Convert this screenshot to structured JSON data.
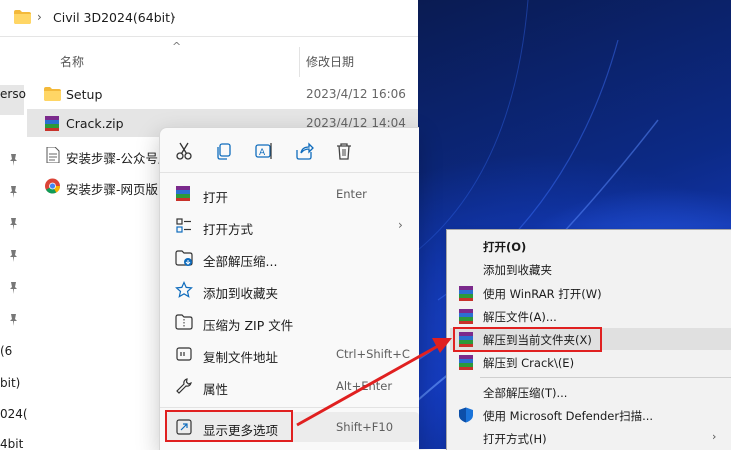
{
  "breadcrumb": {
    "path": "Civil 3D2024(64bit)"
  },
  "columns": {
    "name": "名称",
    "date": "修改日期"
  },
  "files": [
    {
      "name": "Setup",
      "date": "2023/4/12 16:06",
      "icon": "folder-icon"
    },
    {
      "name": "Crack.zip",
      "date": "2023/4/12 14:04",
      "icon": "winrar-archive-icon"
    },
    {
      "name": "安装步骤-公众号版",
      "date": "",
      "icon": "text-document-icon"
    },
    {
      "name": "安装步骤-网页版",
      "date": "",
      "icon": "chrome-icon"
    }
  ],
  "nav_fragments": [
    "erso",
    "(6",
    "bit)",
    "024(",
    "4bit"
  ],
  "context_menu": {
    "quick_actions": [
      "cut-icon",
      "copy-icon",
      "rename-icon",
      "share-icon",
      "delete-icon"
    ],
    "items": [
      {
        "label": "打开",
        "shortcut": "Enter",
        "icon": "winrar-icon"
      },
      {
        "label": "打开方式",
        "shortcut": "",
        "icon": "open-with-icon",
        "submenu": true
      },
      {
        "label": "全部解压缩...",
        "shortcut": "",
        "icon": "extract-all-icon"
      },
      {
        "label": "添加到收藏夹",
        "shortcut": "",
        "icon": "star-icon"
      },
      {
        "label": "压缩为 ZIP 文件",
        "shortcut": "",
        "icon": "zip-icon"
      },
      {
        "label": "复制文件地址",
        "shortcut": "Ctrl+Shift+C",
        "icon": "copy-path-icon"
      },
      {
        "label": "属性",
        "shortcut": "Alt+Enter",
        "icon": "wrench-icon"
      },
      {
        "label": "显示更多选项",
        "shortcut": "Shift+F10",
        "icon": "more-options-icon"
      }
    ]
  },
  "classic_menu": {
    "items": [
      {
        "label": "打开(O)",
        "bold": true,
        "icon": ""
      },
      {
        "label": "添加到收藏夹",
        "icon": ""
      },
      {
        "label": "使用 WinRAR 打开(W)",
        "icon": "winrar-icon"
      },
      {
        "label": "解压文件(A)...",
        "icon": "winrar-icon"
      },
      {
        "label": "解压到当前文件夹(X)",
        "icon": "winrar-icon",
        "highlighted": true
      },
      {
        "label": "解压到 Crack\\(E)",
        "icon": "winrar-icon"
      },
      {
        "label": "全部解压缩(T)...",
        "icon": ""
      },
      {
        "label": "使用 Microsoft Defender扫描...",
        "icon": "defender-shield-icon"
      },
      {
        "label": "打开方式(H)",
        "icon": "",
        "submenu": true
      }
    ]
  },
  "colors": {
    "highlight_box": "#e02020",
    "arrow": "#e02020",
    "accent": "#0f6cbd"
  }
}
